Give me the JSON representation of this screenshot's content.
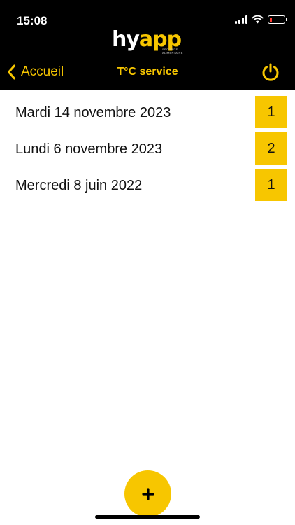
{
  "status_bar": {
    "time": "15:08",
    "battery_level_fraction": 0.15,
    "battery_color": "#ff3b30"
  },
  "logo": {
    "text_white": "hy",
    "text_yellow": "app",
    "tagline_1": "SÉCURITÉ",
    "tagline_2": "ALIMENTAIRE"
  },
  "nav": {
    "back_label": "Accueil",
    "back_icon": "chevron-left-icon",
    "title": "T°C service",
    "power_icon": "power-icon"
  },
  "entries": [
    {
      "date": "Mardi 14 novembre 2023",
      "count": "1"
    },
    {
      "date": "Lundi 6 novembre 2023",
      "count": "2"
    },
    {
      "date": "Mercredi 8 juin 2022",
      "count": "1"
    }
  ],
  "fab": {
    "icon": "plus-icon"
  },
  "colors": {
    "accent": "#f7c600",
    "header_background": "#000000",
    "page_background": "#ffffff"
  }
}
